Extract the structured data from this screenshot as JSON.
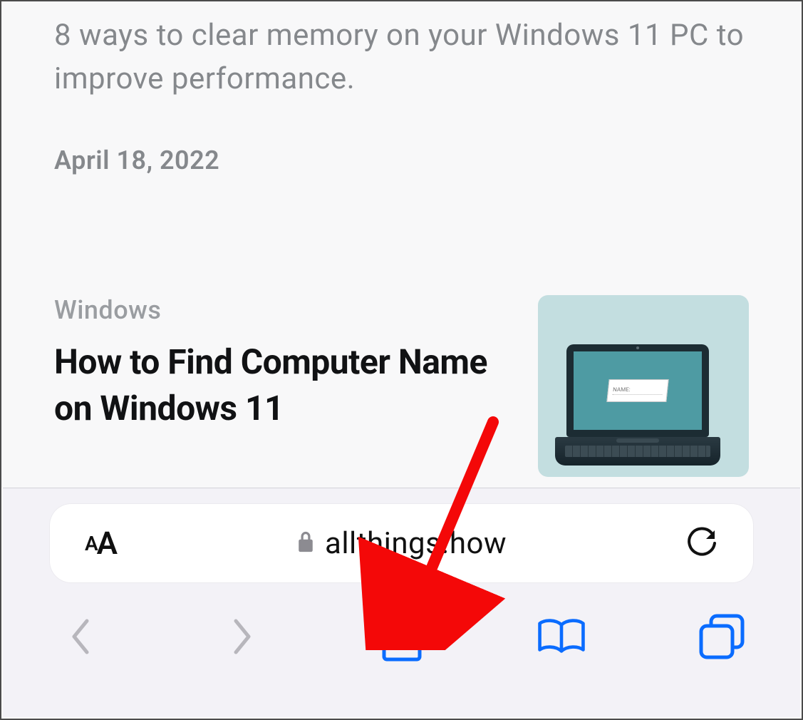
{
  "content": {
    "prev_article_excerpt": "8 ways to clear memory on your Windows 11 PC to improve performance.",
    "prev_article_date": "April 18, 2022",
    "article": {
      "category": "Windows",
      "title": "How to Find Computer Name on Windows 11",
      "thumb_label_title": "NAME:"
    }
  },
  "browser": {
    "domain": "allthings.how",
    "aa_small": "A",
    "aa_big": "A"
  },
  "colors": {
    "accent": "#0a6cff",
    "annotation": "#f40808"
  }
}
